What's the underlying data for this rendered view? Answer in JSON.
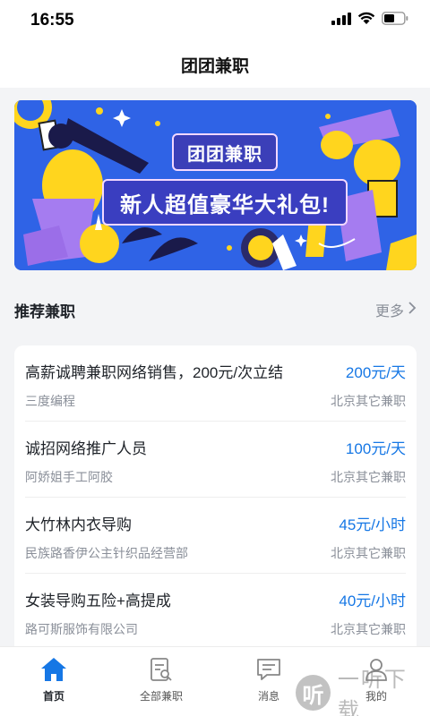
{
  "status": {
    "time": "16:55",
    "icons": [
      "signal-icon",
      "wifi-icon",
      "battery-icon"
    ]
  },
  "nav": {
    "title": "团团兼职"
  },
  "banner": {
    "tag": "团团兼职",
    "slogan": "新人超值豪华大礼包!",
    "colors": {
      "background": "#2f63e6",
      "panel": "#3a3ec0",
      "accent_yellow": "#ffd51e",
      "accent_purple": "#a57cf0"
    }
  },
  "section": {
    "title": "推荐兼职",
    "more_label": "更多"
  },
  "jobs": [
    {
      "title": "高薪诚聘兼职网络销售，200元/次立结",
      "salary": "200元/天",
      "company": "三度编程",
      "location": "北京其它兼职"
    },
    {
      "title": "诚招网络推广人员",
      "salary": "100元/天",
      "company": "阿娇姐手工阿胶",
      "location": "北京其它兼职"
    },
    {
      "title": "大竹林内衣导购",
      "salary": "45元/小时",
      "company": "民族路香伊公主针织品经营部",
      "location": "北京其它兼职"
    },
    {
      "title": "女装导购五险+高提成",
      "salary": "40元/小时",
      "company": "路可斯服饰有限公司",
      "location": "北京其它兼职"
    }
  ],
  "tabs": [
    {
      "label": "首页",
      "icon": "home-icon",
      "active": true
    },
    {
      "label": "全部兼职",
      "icon": "job-list-icon",
      "active": false
    },
    {
      "label": "消息",
      "icon": "message-icon",
      "active": false
    },
    {
      "label": "我的",
      "icon": "profile-icon",
      "active": false
    }
  ],
  "watermark": {
    "circle": "听",
    "text": "一听下载"
  },
  "colors": {
    "accent": "#1677e5",
    "active_tab": "#1677e5",
    "muted_text": "#8a8f99"
  }
}
